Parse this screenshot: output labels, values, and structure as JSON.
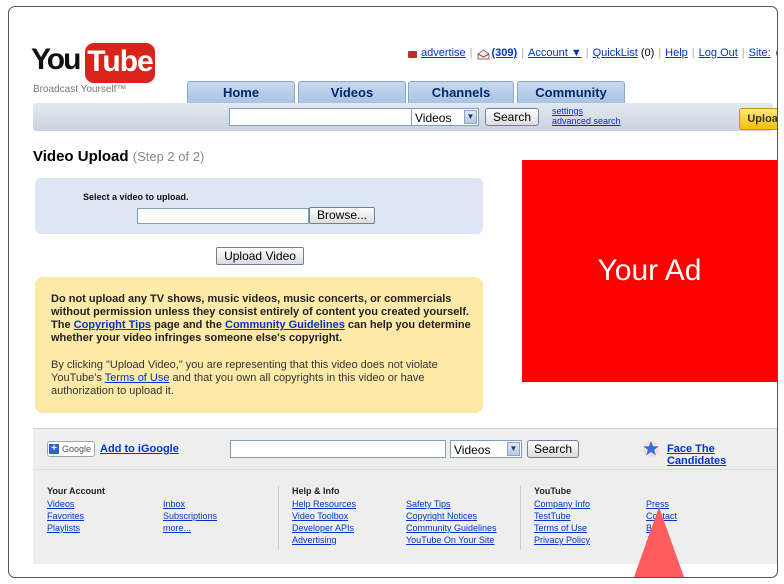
{
  "logo": {
    "you": "You",
    "tube": "Tube",
    "slogan": "Broadcast Yourself™"
  },
  "toplinks": {
    "advertise": "advertise",
    "inbox_count": "(309)",
    "account": "Account ▼",
    "quicklist": "QuickList",
    "quicklist_count": "(0)",
    "help": "Help",
    "logout": "Log Out",
    "site": "Site:"
  },
  "tabs": [
    "Home",
    "Videos",
    "Channels",
    "Community"
  ],
  "search": {
    "select_value": "Videos",
    "button": "Search",
    "settings": "settings",
    "advanced": "advanced search",
    "upload": "Upload"
  },
  "page": {
    "title": "Video Upload",
    "step": "(Step 2 of 2)"
  },
  "upload_form": {
    "label": "Select a video to upload.",
    "browse": "Browse...",
    "submit": "Upload Video"
  },
  "notice": {
    "warn_1": "Do not upload any TV shows, music videos, music concerts, or commercials without permission unless they consist entirely of content you created yourself. The ",
    "copyright_tips": "Copyright Tips",
    "warn_2": " page and the ",
    "community_guidelines": "Community Guidelines",
    "warn_3": " can help you determine whether your video infringes someone else's copyright.",
    "legal_1": "By clicking \"Upload Video,\" you are representing that this video does not violate YouTube's ",
    "terms_of_use": "Terms of Use",
    "legal_2": " and that you own all copyrights in this video or have authorization to upload it."
  },
  "ad": {
    "text": "Your Ad"
  },
  "footer": {
    "google": "Google",
    "add_igoogle": "Add to iGoogle",
    "select_value": "Videos",
    "search": "Search",
    "candidates": "Face The Candidates",
    "columns": [
      {
        "title": "Your Account",
        "links": [
          "Videos",
          "Favorites",
          "Playlists"
        ],
        "links2": [
          "Inbox",
          "Subscriptions",
          "more..."
        ]
      },
      {
        "title": "Help & Info",
        "links": [
          "Help Resources",
          "Video Toolbox",
          "Developer APIs",
          "Advertising"
        ],
        "links2": [
          "Safety Tips",
          "Copyright Notices",
          "Community Guidelines",
          "YouTube On Your Site"
        ]
      },
      {
        "title": "YouTube",
        "links": [
          "Company Info",
          "TestTube",
          "Terms of Use",
          "Privacy Policy"
        ],
        "links2": [
          "Press",
          "Contact",
          "Blog",
          "Jobs"
        ]
      }
    ]
  },
  "colors": {
    "brand_red": "#d9241c",
    "link": "#0033cc",
    "notice_bg": "#fde9a8",
    "ad_red": "#ff0000"
  }
}
